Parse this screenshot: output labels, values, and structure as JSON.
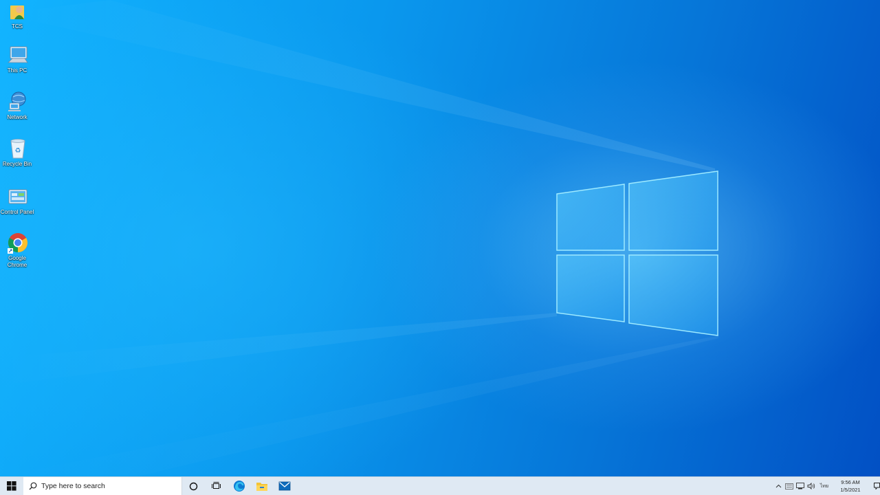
{
  "desktop": {
    "icons": [
      {
        "label": "TCS",
        "icon": "user-folder-icon"
      },
      {
        "label": "This PC",
        "icon": "computer-icon"
      },
      {
        "label": "Network",
        "icon": "network-icon"
      },
      {
        "label": "Recycle Bin",
        "icon": "recycle-bin-icon"
      },
      {
        "label": "Control Panel",
        "icon": "control-panel-icon"
      },
      {
        "label": "Google Chrome",
        "icon": "chrome-icon"
      }
    ]
  },
  "taskbar": {
    "search_placeholder": "Type here to search",
    "pinned": [
      {
        "name": "Cortana",
        "icon": "cortana-icon"
      },
      {
        "name": "Task View",
        "icon": "task-view-icon"
      },
      {
        "name": "Microsoft Edge",
        "icon": "edge-icon"
      },
      {
        "name": "File Explorer",
        "icon": "file-explorer-icon"
      },
      {
        "name": "Mail",
        "icon": "mail-icon"
      }
    ],
    "tray": {
      "language": "ไทย",
      "time": "9:56 AM",
      "date": "1/5/2021"
    }
  },
  "colors": {
    "wallpaper_light": "#12b4ff",
    "wallpaper_dark": "#0250c4",
    "taskbar_bg": "#dfe9f3",
    "accent": "#0078d7"
  }
}
